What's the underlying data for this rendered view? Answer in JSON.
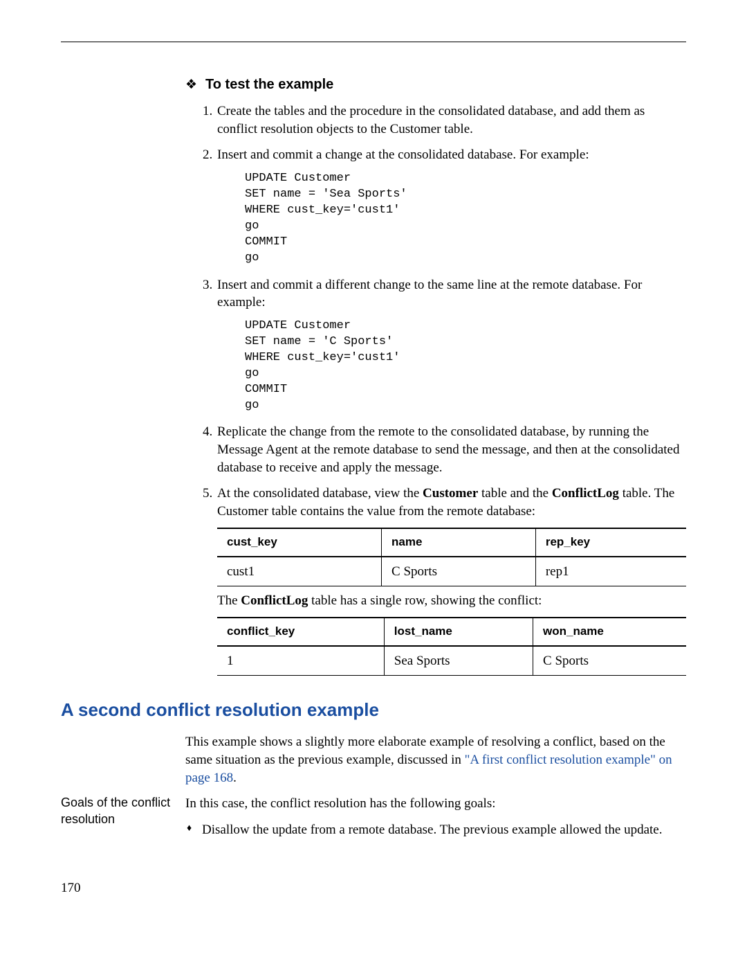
{
  "heading1": "To test the example",
  "steps": {
    "s1": "Create the tables and the procedure in the consolidated database, and add them as conflict resolution objects to the Customer table.",
    "s2": "Insert and commit a change at the consolidated database. For example:",
    "code2": "UPDATE Customer\nSET name = 'Sea Sports'\nWHERE cust_key='cust1'\ngo\nCOMMIT\ngo",
    "s3": "Insert and commit a different change to the same line at the remote database. For example:",
    "code3": "UPDATE Customer\nSET name = 'C Sports'\nWHERE cust_key='cust1'\ngo\nCOMMIT\ngo",
    "s4": "Replicate the change from the remote to the consolidated database, by running the Message Agent at the remote database to send the message, and then at the consolidated database to receive and apply the message.",
    "s5_pre": "At the consolidated database, view the ",
    "s5_bold1": "Customer",
    "s5_mid": " table and the ",
    "s5_bold2": "ConflictLog",
    "s5_post": " table. The Customer table contains the value from the remote database:"
  },
  "table1": {
    "headers": [
      "cust_key",
      "name",
      "rep_key"
    ],
    "row": [
      "cust1",
      "C Sports",
      "rep1"
    ]
  },
  "table_note_pre": "The ",
  "table_note_bold": "ConflictLog",
  "table_note_post": " table has a single row, showing the conflict:",
  "table2": {
    "headers": [
      "conflict_key",
      "lost_name",
      "won_name"
    ],
    "row": [
      "1",
      "Sea Sports",
      "C Sports"
    ]
  },
  "section2_heading": "A second conflict resolution example",
  "section2_intro_pre": "This example shows a slightly more elaborate example of resolving a conflict, based on the same situation as the previous example, discussed in ",
  "section2_intro_link": "\"A first conflict resolution example\" on page 168",
  "section2_intro_post": ".",
  "margin_note": "Goals of the conflict resolution",
  "goals_intro": "In this case, the conflict resolution has the following goals:",
  "goal1": "Disallow the update from a remote database. The previous example allowed the update.",
  "page_number": "170"
}
